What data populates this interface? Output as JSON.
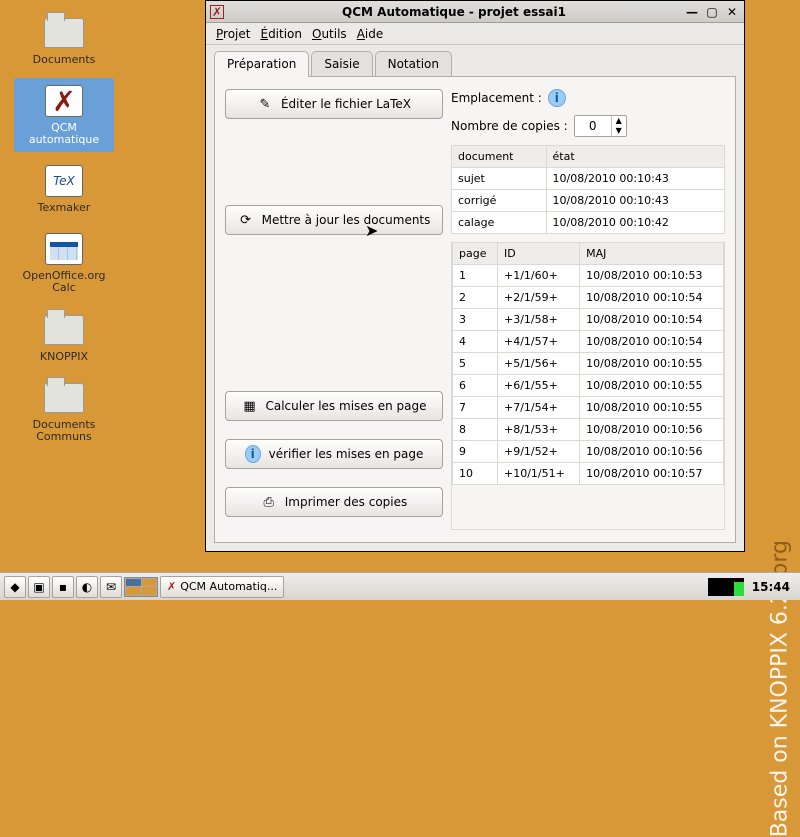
{
  "desktop": {
    "watermark_a": "Based on KNOPPIX 6.2",
    "watermark_b": ".org",
    "icons": [
      {
        "label": "Documents",
        "type": "folder"
      },
      {
        "label": "QCM automatique",
        "type": "qcm",
        "selected": true
      },
      {
        "label": "Texmaker",
        "type": "tex"
      },
      {
        "label": "OpenOffice.org Calc",
        "type": "calc"
      },
      {
        "label": "KNOPPIX",
        "type": "folder"
      },
      {
        "label": "Documents Communs",
        "type": "folder"
      }
    ]
  },
  "window": {
    "title": "QCM Automatique - projet essai1",
    "menu": [
      "Projet",
      "Édition",
      "Outils",
      "Aide"
    ],
    "tabs": [
      "Préparation",
      "Saisie",
      "Notation"
    ],
    "active_tab": 0,
    "buttons": {
      "edit_latex": "Éditer le fichier LaTeX",
      "update_docs": "Mettre à jour les documents",
      "calc_layout": "Calculer les mises en page",
      "verify_layout": "vérifier les mises en page",
      "print": "Imprimer des copies"
    },
    "right": {
      "emplacement_label": "Emplacement :",
      "copies_label": "Nombre de copies :",
      "copies_value": "0",
      "docs_headers": [
        "document",
        "état"
      ],
      "docs": [
        {
          "name": "sujet",
          "state": "10/08/2010 00:10:43"
        },
        {
          "name": "corrigé",
          "state": "10/08/2010 00:10:43"
        },
        {
          "name": "calage",
          "state": "10/08/2010 00:10:42"
        }
      ],
      "pages_headers": [
        "page",
        "ID",
        "MAJ"
      ],
      "pages": [
        {
          "page": "1",
          "id": "+1/1/60+",
          "maj": "10/08/2010 00:10:53"
        },
        {
          "page": "2",
          "id": "+2/1/59+",
          "maj": "10/08/2010 00:10:54"
        },
        {
          "page": "3",
          "id": "+3/1/58+",
          "maj": "10/08/2010 00:10:54"
        },
        {
          "page": "4",
          "id": "+4/1/57+",
          "maj": "10/08/2010 00:10:54"
        },
        {
          "page": "5",
          "id": "+5/1/56+",
          "maj": "10/08/2010 00:10:55"
        },
        {
          "page": "6",
          "id": "+6/1/55+",
          "maj": "10/08/2010 00:10:55"
        },
        {
          "page": "7",
          "id": "+7/1/54+",
          "maj": "10/08/2010 00:10:55"
        },
        {
          "page": "8",
          "id": "+8/1/53+",
          "maj": "10/08/2010 00:10:56"
        },
        {
          "page": "9",
          "id": "+9/1/52+",
          "maj": "10/08/2010 00:10:56"
        },
        {
          "page": "10",
          "id": "+10/1/51+",
          "maj": "10/08/2010 00:10:57"
        }
      ]
    }
  },
  "taskbar": {
    "app_label": "QCM Automatiq...",
    "clock": "15:44"
  }
}
